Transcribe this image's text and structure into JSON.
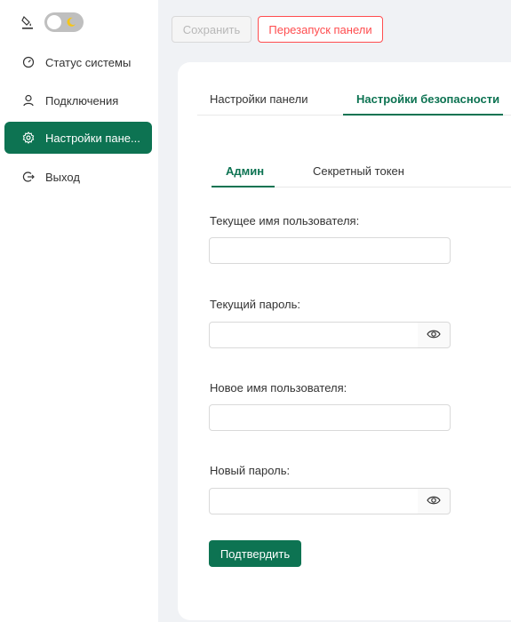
{
  "sidebar": {
    "items": [
      {
        "label": "Статус системы",
        "icon": "dashboard-icon"
      },
      {
        "label": "Подключения",
        "icon": "user-icon"
      },
      {
        "label": "Настройки пане...",
        "icon": "gear-icon",
        "active": true
      },
      {
        "label": "Выход",
        "icon": "logout-icon"
      }
    ]
  },
  "toolbar": {
    "save_label": "Сохранить",
    "restart_label": "Перезапуск панели"
  },
  "tabs": [
    {
      "label": "Настройки панели"
    },
    {
      "label": "Настройки безопасности",
      "active": true
    }
  ],
  "subtabs": [
    {
      "label": "Админ",
      "active": true
    },
    {
      "label": "Секретный токен"
    }
  ],
  "form": {
    "current_username_label": "Текущее имя пользователя:",
    "current_password_label": "Текущий пароль:",
    "new_username_label": "Новое имя пользователя:",
    "new_password_label": "Новый пароль:",
    "current_username_value": "",
    "current_password_value": "",
    "new_username_value": "",
    "new_password_value": "",
    "confirm_label": "Подтвердить"
  },
  "colors": {
    "accent": "#0d7352",
    "danger": "#ff4d4f",
    "background": "#f0f2f5"
  }
}
